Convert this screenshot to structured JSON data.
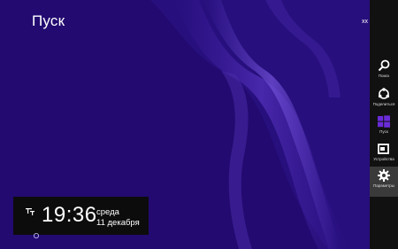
{
  "screen": {
    "title": "Пуск",
    "user_label": "xx"
  },
  "charms": [
    {
      "label": "Поиск",
      "icon": "search-icon"
    },
    {
      "label": "Поделиться",
      "icon": "share-icon"
    },
    {
      "label": "Пуск",
      "icon": "windows-logo-icon"
    },
    {
      "label": "Устройства",
      "icon": "devices-icon"
    },
    {
      "label": "Параметры",
      "icon": "gear-icon",
      "active": true
    }
  ],
  "clock": {
    "time": "19:36",
    "day": "среда",
    "date": "11 декабря",
    "status_icon": "network-icon"
  },
  "colors": {
    "background": "#220a70",
    "charms_bar": "#111111",
    "windows_logo": "#6a2bd8"
  }
}
